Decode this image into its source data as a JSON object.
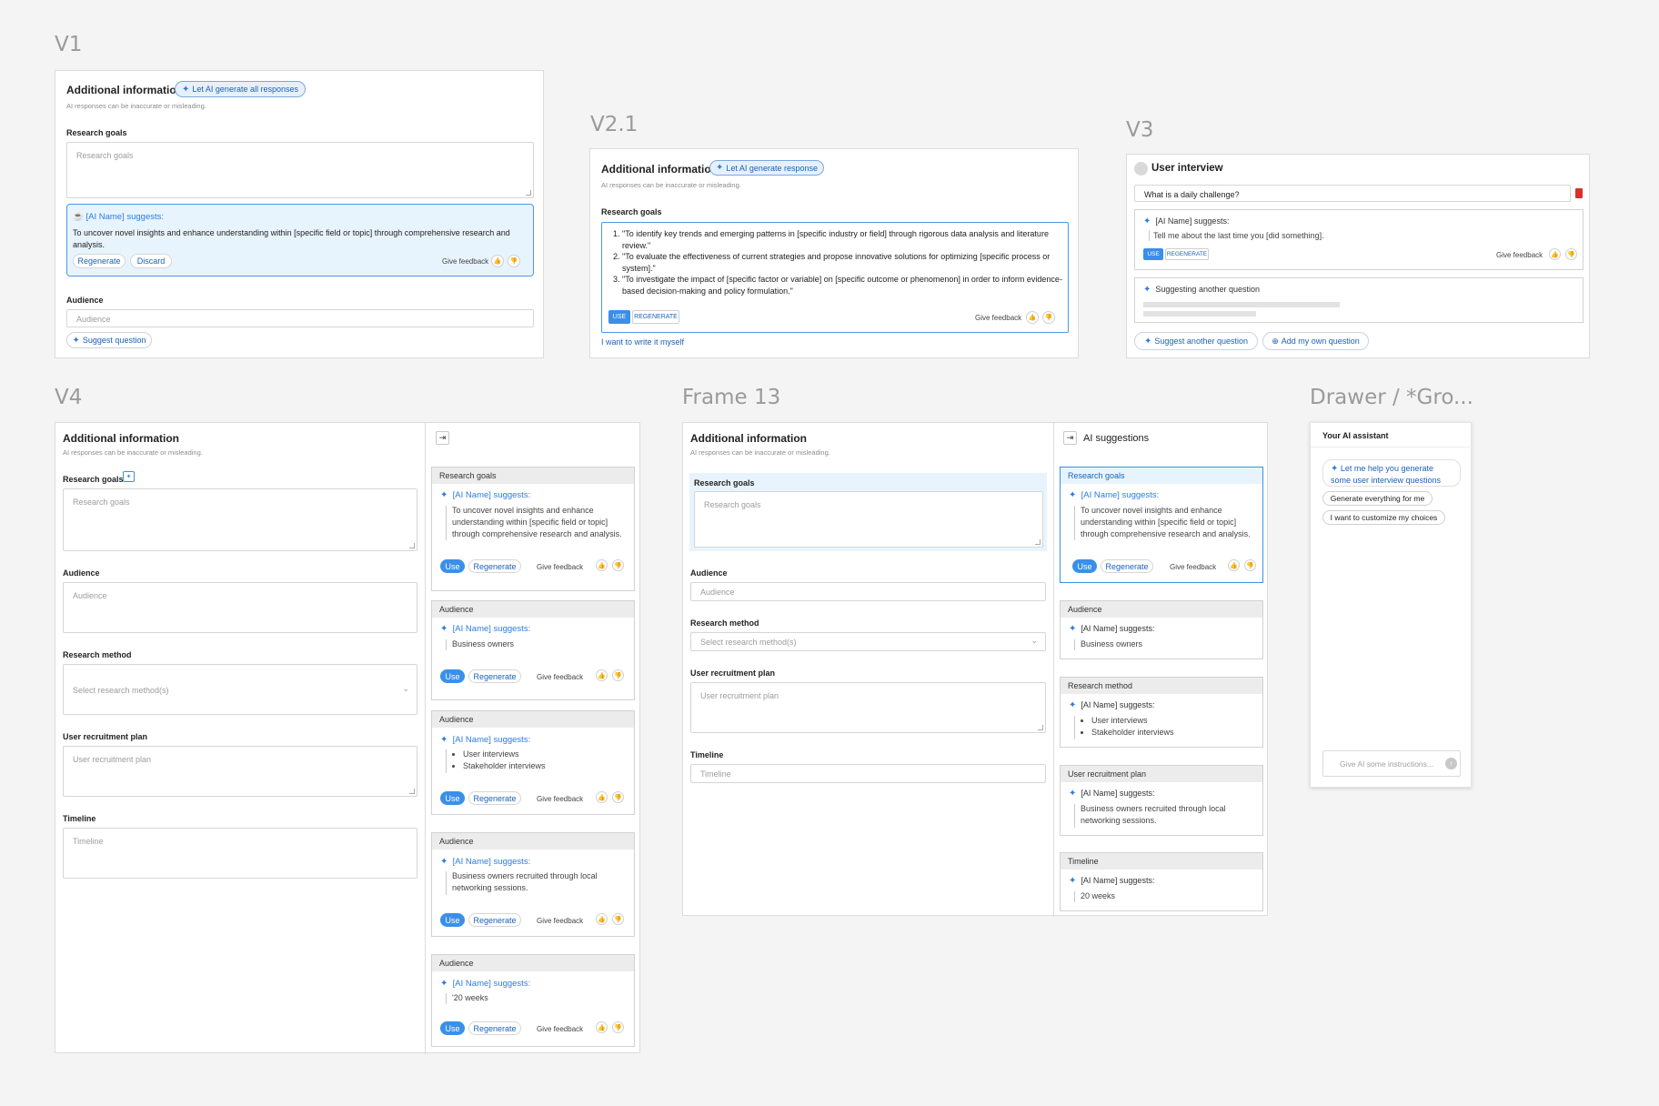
{
  "labels": {
    "v1": "V1",
    "v21": "V2.1",
    "v3": "V3",
    "v4": "V4",
    "frame13": "Frame 13",
    "drawer": "Drawer / *Gro..."
  },
  "common": {
    "additional_info": "Additional information",
    "disclaimer": "AI responses can be inaccurate or misleading.",
    "research_goals": "Research goals",
    "audience": "Audience",
    "research_method": "Research method",
    "select_method": "Select research method(s)",
    "user_recruitment_plan": "User recruitment plan",
    "timeline": "Timeline",
    "ai_suggests": "[AI Name] suggests:",
    "use": "Use",
    "regenerate": "Regenerate",
    "give_feedback": "Give feedback",
    "suggestion_goals": "To uncover novel insights and enhance understanding within [specific field or topic] through comprehensive research and analysis.",
    "business_owners": "Business owners",
    "user_interviews": "User interviews",
    "stakeholder_interviews": "Stakeholder interviews",
    "recruit_suggestion": "Business owners recruited through local networking sessions.",
    "weeks": "20 weeks",
    "weeks_q": "'20 weeks"
  },
  "v1": {
    "ai_button": "Let AI generate all responses",
    "discard": "Discard",
    "suggest_question": "Suggest question"
  },
  "v21": {
    "ai_button": "Let AI generate response",
    "items": [
      "\"To identify key trends and emerging patterns in [specific industry or field] through rigorous data analysis and literature review.\"",
      "\"To evaluate the effectiveness of current strategies and propose innovative solutions for optimizing [specific process or system].\"",
      "\"To investigate the impact of [specific factor or variable] on [specific outcome or phenomenon] in order to inform evidence-based decision-making and policy formulation.\""
    ],
    "use": "USE",
    "regenerate": "REGENERATE",
    "write_myself": "I want to write it myself"
  },
  "v3": {
    "title": "User interview",
    "question": "What is a daily challenge?",
    "suggestion": "Tell me about the last time you [did something].",
    "use": "USE",
    "regenerate": "REGENERATE",
    "suggesting": "Suggesting another question",
    "suggest_another": "Suggest another question",
    "add_own": "Add my own question"
  },
  "frame13": {
    "panel_title": "AI suggestions"
  },
  "drawer": {
    "title": "Your AI assistant",
    "prompt": "Let me help you generate some user interview questions",
    "opt1": "Generate everything for me",
    "opt2": "I want to customize my choices",
    "input_placeholder": "Give AI some instructions..."
  },
  "colors": {
    "accent": "#3b8fe8",
    "link": "#1b61b7",
    "highlight": "#e8f4fd",
    "delete": "#d9302c"
  }
}
